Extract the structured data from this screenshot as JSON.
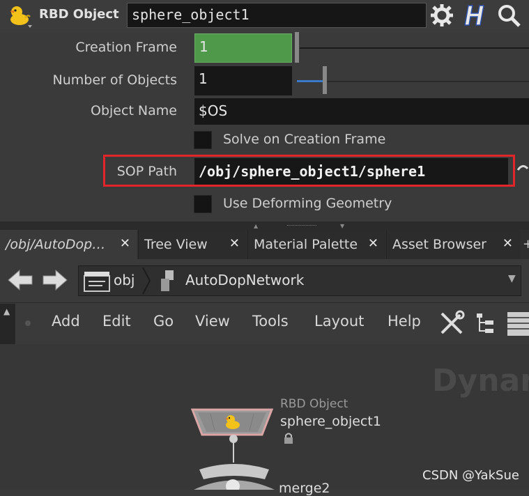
{
  "header": {
    "node_type": "RBD Object",
    "node_name": "sphere_object1"
  },
  "params": {
    "creation_frame": {
      "label": "Creation Frame",
      "value": "1"
    },
    "number_of_objects": {
      "label": "Number of Objects",
      "value": "1"
    },
    "object_name": {
      "label": "Object Name",
      "value": "$OS"
    },
    "solve_on_creation_frame": {
      "label": "Solve on Creation Frame",
      "checked": false
    },
    "sop_path": {
      "label": "SOP Path",
      "value": "/obj/sphere_object1/sphere1"
    },
    "use_deforming_geometry": {
      "label": "Use Deforming Geometry",
      "checked": false
    }
  },
  "tabs": [
    {
      "label": "/obj/AutoDop…",
      "close": "✕"
    },
    {
      "label": "Tree View",
      "close": "✕"
    },
    {
      "label": "Material Palette",
      "close": "✕"
    },
    {
      "label": "Asset Browser",
      "close": "✕"
    }
  ],
  "path": {
    "segments": [
      "obj",
      "AutoDopNetwork"
    ]
  },
  "menu": [
    "Add",
    "Edit",
    "Go",
    "View",
    "Tools",
    "Layout",
    "Help"
  ],
  "network": {
    "watermark": "Dynan",
    "node1": {
      "type": "RBD Object",
      "name": "sphere_object1"
    },
    "node2": {
      "name": "merge2"
    }
  },
  "credit": "CSDN @YakSue",
  "colors": {
    "highlight": "#e2242b",
    "creation_frame_bg": "#4e9a4a"
  }
}
